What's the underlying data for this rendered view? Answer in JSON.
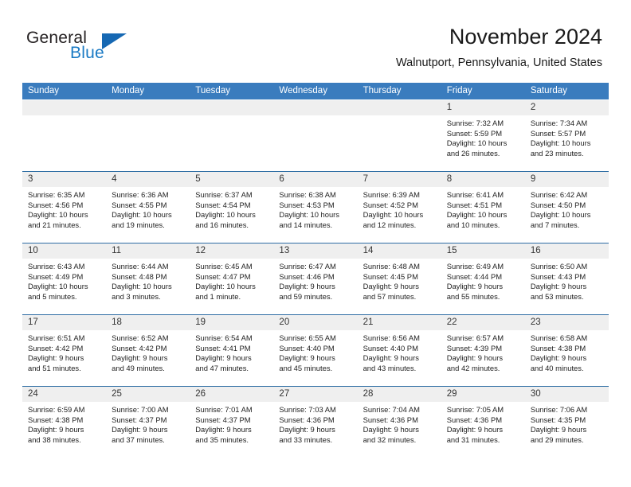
{
  "brand": {
    "word_one": "General",
    "word_two": "Blue",
    "triangle_color": "#1668b3",
    "blue_text_color": "#1a7ac4"
  },
  "header": {
    "title": "November 2024",
    "subtitle": "Walnutport, Pennsylvania, United States"
  },
  "theme": {
    "header_row_bg": "#3a7cbe",
    "week_separator": "#2e6da4",
    "day_number_bg": "#efefef"
  },
  "weekdays": [
    "Sunday",
    "Monday",
    "Tuesday",
    "Wednesday",
    "Thursday",
    "Friday",
    "Saturday"
  ],
  "labels": {
    "sunrise": "Sunrise:",
    "sunset": "Sunset:",
    "daylight": "Daylight:"
  },
  "weeks": [
    [
      {
        "date": "",
        "empty": true
      },
      {
        "date": "",
        "empty": true
      },
      {
        "date": "",
        "empty": true
      },
      {
        "date": "",
        "empty": true
      },
      {
        "date": "",
        "empty": true
      },
      {
        "date": "1",
        "sunrise": "Sunrise: 7:32 AM",
        "sunset": "Sunset: 5:59 PM",
        "daylight_line1": "Daylight: 10 hours",
        "daylight_line2": "and 26 minutes."
      },
      {
        "date": "2",
        "sunrise": "Sunrise: 7:34 AM",
        "sunset": "Sunset: 5:57 PM",
        "daylight_line1": "Daylight: 10 hours",
        "daylight_line2": "and 23 minutes."
      }
    ],
    [
      {
        "date": "3",
        "sunrise": "Sunrise: 6:35 AM",
        "sunset": "Sunset: 4:56 PM",
        "daylight_line1": "Daylight: 10 hours",
        "daylight_line2": "and 21 minutes."
      },
      {
        "date": "4",
        "sunrise": "Sunrise: 6:36 AM",
        "sunset": "Sunset: 4:55 PM",
        "daylight_line1": "Daylight: 10 hours",
        "daylight_line2": "and 19 minutes."
      },
      {
        "date": "5",
        "sunrise": "Sunrise: 6:37 AM",
        "sunset": "Sunset: 4:54 PM",
        "daylight_line1": "Daylight: 10 hours",
        "daylight_line2": "and 16 minutes."
      },
      {
        "date": "6",
        "sunrise": "Sunrise: 6:38 AM",
        "sunset": "Sunset: 4:53 PM",
        "daylight_line1": "Daylight: 10 hours",
        "daylight_line2": "and 14 minutes."
      },
      {
        "date": "7",
        "sunrise": "Sunrise: 6:39 AM",
        "sunset": "Sunset: 4:52 PM",
        "daylight_line1": "Daylight: 10 hours",
        "daylight_line2": "and 12 minutes."
      },
      {
        "date": "8",
        "sunrise": "Sunrise: 6:41 AM",
        "sunset": "Sunset: 4:51 PM",
        "daylight_line1": "Daylight: 10 hours",
        "daylight_line2": "and 10 minutes."
      },
      {
        "date": "9",
        "sunrise": "Sunrise: 6:42 AM",
        "sunset": "Sunset: 4:50 PM",
        "daylight_line1": "Daylight: 10 hours",
        "daylight_line2": "and 7 minutes."
      }
    ],
    [
      {
        "date": "10",
        "sunrise": "Sunrise: 6:43 AM",
        "sunset": "Sunset: 4:49 PM",
        "daylight_line1": "Daylight: 10 hours",
        "daylight_line2": "and 5 minutes."
      },
      {
        "date": "11",
        "sunrise": "Sunrise: 6:44 AM",
        "sunset": "Sunset: 4:48 PM",
        "daylight_line1": "Daylight: 10 hours",
        "daylight_line2": "and 3 minutes."
      },
      {
        "date": "12",
        "sunrise": "Sunrise: 6:45 AM",
        "sunset": "Sunset: 4:47 PM",
        "daylight_line1": "Daylight: 10 hours",
        "daylight_line2": "and 1 minute."
      },
      {
        "date": "13",
        "sunrise": "Sunrise: 6:47 AM",
        "sunset": "Sunset: 4:46 PM",
        "daylight_line1": "Daylight: 9 hours",
        "daylight_line2": "and 59 minutes."
      },
      {
        "date": "14",
        "sunrise": "Sunrise: 6:48 AM",
        "sunset": "Sunset: 4:45 PM",
        "daylight_line1": "Daylight: 9 hours",
        "daylight_line2": "and 57 minutes."
      },
      {
        "date": "15",
        "sunrise": "Sunrise: 6:49 AM",
        "sunset": "Sunset: 4:44 PM",
        "daylight_line1": "Daylight: 9 hours",
        "daylight_line2": "and 55 minutes."
      },
      {
        "date": "16",
        "sunrise": "Sunrise: 6:50 AM",
        "sunset": "Sunset: 4:43 PM",
        "daylight_line1": "Daylight: 9 hours",
        "daylight_line2": "and 53 minutes."
      }
    ],
    [
      {
        "date": "17",
        "sunrise": "Sunrise: 6:51 AM",
        "sunset": "Sunset: 4:42 PM",
        "daylight_line1": "Daylight: 9 hours",
        "daylight_line2": "and 51 minutes."
      },
      {
        "date": "18",
        "sunrise": "Sunrise: 6:52 AM",
        "sunset": "Sunset: 4:42 PM",
        "daylight_line1": "Daylight: 9 hours",
        "daylight_line2": "and 49 minutes."
      },
      {
        "date": "19",
        "sunrise": "Sunrise: 6:54 AM",
        "sunset": "Sunset: 4:41 PM",
        "daylight_line1": "Daylight: 9 hours",
        "daylight_line2": "and 47 minutes."
      },
      {
        "date": "20",
        "sunrise": "Sunrise: 6:55 AM",
        "sunset": "Sunset: 4:40 PM",
        "daylight_line1": "Daylight: 9 hours",
        "daylight_line2": "and 45 minutes."
      },
      {
        "date": "21",
        "sunrise": "Sunrise: 6:56 AM",
        "sunset": "Sunset: 4:40 PM",
        "daylight_line1": "Daylight: 9 hours",
        "daylight_line2": "and 43 minutes."
      },
      {
        "date": "22",
        "sunrise": "Sunrise: 6:57 AM",
        "sunset": "Sunset: 4:39 PM",
        "daylight_line1": "Daylight: 9 hours",
        "daylight_line2": "and 42 minutes."
      },
      {
        "date": "23",
        "sunrise": "Sunrise: 6:58 AM",
        "sunset": "Sunset: 4:38 PM",
        "daylight_line1": "Daylight: 9 hours",
        "daylight_line2": "and 40 minutes."
      }
    ],
    [
      {
        "date": "24",
        "sunrise": "Sunrise: 6:59 AM",
        "sunset": "Sunset: 4:38 PM",
        "daylight_line1": "Daylight: 9 hours",
        "daylight_line2": "and 38 minutes."
      },
      {
        "date": "25",
        "sunrise": "Sunrise: 7:00 AM",
        "sunset": "Sunset: 4:37 PM",
        "daylight_line1": "Daylight: 9 hours",
        "daylight_line2": "and 37 minutes."
      },
      {
        "date": "26",
        "sunrise": "Sunrise: 7:01 AM",
        "sunset": "Sunset: 4:37 PM",
        "daylight_line1": "Daylight: 9 hours",
        "daylight_line2": "and 35 minutes."
      },
      {
        "date": "27",
        "sunrise": "Sunrise: 7:03 AM",
        "sunset": "Sunset: 4:36 PM",
        "daylight_line1": "Daylight: 9 hours",
        "daylight_line2": "and 33 minutes."
      },
      {
        "date": "28",
        "sunrise": "Sunrise: 7:04 AM",
        "sunset": "Sunset: 4:36 PM",
        "daylight_line1": "Daylight: 9 hours",
        "daylight_line2": "and 32 minutes."
      },
      {
        "date": "29",
        "sunrise": "Sunrise: 7:05 AM",
        "sunset": "Sunset: 4:36 PM",
        "daylight_line1": "Daylight: 9 hours",
        "daylight_line2": "and 31 minutes."
      },
      {
        "date": "30",
        "sunrise": "Sunrise: 7:06 AM",
        "sunset": "Sunset: 4:35 PM",
        "daylight_line1": "Daylight: 9 hours",
        "daylight_line2": "and 29 minutes."
      }
    ]
  ]
}
